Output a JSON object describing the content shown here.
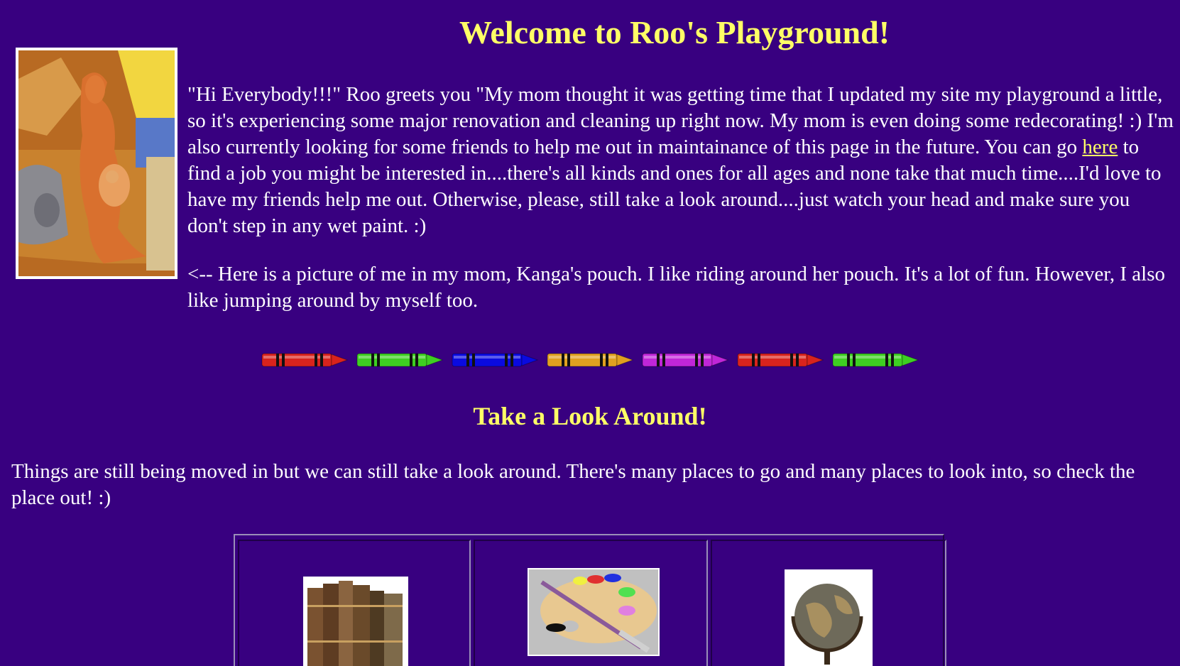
{
  "title": "Welcome to Roo's Playground!",
  "intro": {
    "before_link": "\"Hi Everybody!!!\" Roo greets you \"My mom thought it was getting time that I updated my site my playground a little, so it's experiencing some major renovation and cleaning up right now. My mom is even doing some redecorating! :) I'm also currently looking for some friends to help me out in maintainance of this page in the future. You can go ",
    "link_text": "here",
    "after_link": " to find a job you might be interested in....there's all kinds and ones for all ages and none take that much time....I'd love to have my friends help me out. Otherwise, please, still take a look around....just watch your head and make sure you don't step in any wet paint. :)"
  },
  "caption": "<-- Here is a picture of me in my mom, Kanga's pouch. I like riding around her pouch. It's a lot of fun. However, I also like jumping around by myself too.",
  "crayon_colors": [
    "#d8231d",
    "#3ecf22",
    "#0a0ae0",
    "#e0a020",
    "#c026d8",
    "#d8231d",
    "#3ecf22"
  ],
  "section": {
    "heading": "Take a Look Around!",
    "body": "Things are still being moved in but we can still take a look around. There's many places to go and many places to look into, so check the place out! :)"
  },
  "nav_icons": [
    "books-icon",
    "paint-palette-icon",
    "globe-icon"
  ],
  "colors": {
    "background": "#380080",
    "heading": "#ffff66",
    "text": "#ffffff",
    "link": "#ffff66"
  }
}
